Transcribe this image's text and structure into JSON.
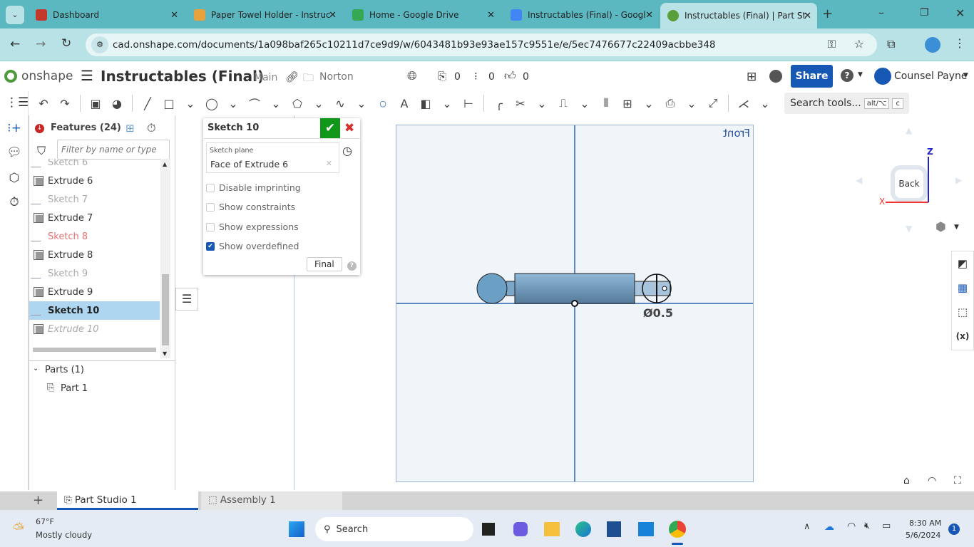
{
  "browser": {
    "tabs": [
      {
        "title": "Dashboard",
        "color": "#c0392b"
      },
      {
        "title": "Paper Towel Holder - Instruc",
        "color": "#e6a23c"
      },
      {
        "title": "Home - Google Drive",
        "color": "#34a853"
      },
      {
        "title": "Instructables (Final) - Googl",
        "color": "#4285f4"
      },
      {
        "title": "Instructables (Final) | Part St",
        "color": "#5a9e3a",
        "active": true
      }
    ],
    "url": "cad.onshape.com/documents/1a098baf265c10211d7ce9d9/w/6043481b93e93ae157c9551e/e/5ec7476677c22409acbbe348"
  },
  "header": {
    "logo": "onshape",
    "doc_title": "Instructables (Final)",
    "branch": "Main",
    "folder": "Norton",
    "versions": "0",
    "branches": "0",
    "likes": "0",
    "share": "Share",
    "user": "Counsel Payne"
  },
  "toolbar": {
    "search": "Search tools...",
    "shortcut1": "alt/⌥",
    "shortcut2": "c"
  },
  "features": {
    "title": "Features (24)",
    "filter_placeholder": "Filter by name or type",
    "items": [
      {
        "name": "Sketch 6",
        "type": "sketch",
        "state": "dim"
      },
      {
        "name": "Extrude 6",
        "type": "extrude",
        "state": "normal"
      },
      {
        "name": "Sketch 7",
        "type": "sketch",
        "state": "dim"
      },
      {
        "name": "Extrude 7",
        "type": "extrude",
        "state": "normal"
      },
      {
        "name": "Sketch 8",
        "type": "sketch",
        "state": "error"
      },
      {
        "name": "Extrude 8",
        "type": "extrude",
        "state": "normal"
      },
      {
        "name": "Sketch 9",
        "type": "sketch",
        "state": "dim"
      },
      {
        "name": "Extrude 9",
        "type": "extrude",
        "state": "normal"
      },
      {
        "name": "Sketch 10",
        "type": "sketch",
        "state": "selected"
      },
      {
        "name": "Extrude 10",
        "type": "extrude",
        "state": "rolledback"
      }
    ],
    "parts_title": "Parts (1)",
    "parts": [
      "Part 1"
    ]
  },
  "sketch_dialog": {
    "title": "Sketch 10",
    "plane_label": "Sketch plane",
    "plane_value": "Face of Extrude 6",
    "options": [
      {
        "label": "Disable imprinting",
        "checked": false
      },
      {
        "label": "Show constraints",
        "checked": false
      },
      {
        "label": "Show expressions",
        "checked": false
      },
      {
        "label": "Show overdefined",
        "checked": true
      }
    ],
    "final_button": "Final"
  },
  "viewport": {
    "plane_label": "Front",
    "dimension": "Ø0.5",
    "viewcube_face": "Back",
    "axis_x": "X",
    "axis_z": "Z"
  },
  "bottom_tabs": [
    "Part Studio 1",
    "Assembly 1"
  ],
  "taskbar": {
    "temp": "67°F",
    "weather": "Mostly cloudy",
    "search": "Search",
    "time": "8:30 AM",
    "date": "5/6/2024",
    "badge": "1"
  }
}
